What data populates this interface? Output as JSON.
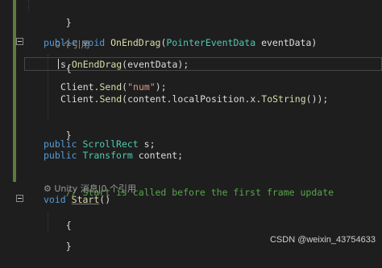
{
  "code": {
    "line_close_brace_top": "}",
    "codelens_refs_1": "0 个引用",
    "method_decl": {
      "kw_public": "public",
      "kw_void": "void",
      "name": "OnEndDrag",
      "open_paren": "(",
      "param_type": "PointerEventData",
      "param_name": " eventData",
      "close_paren": ")"
    },
    "open_brace_1": "{",
    "call_line": {
      "obj": "s.",
      "method": "OnEndDrag",
      "args": "(eventData);"
    },
    "send_line_1": {
      "obj": "Client.",
      "method": "Send",
      "open": "(",
      "string": "\"num\"",
      "close": ");"
    },
    "send_line_2": {
      "obj": "Client.",
      "method": "Send",
      "args_a": "(content.localPosition.x.",
      "method_b": "ToString",
      "args_b": "());"
    },
    "close_brace_1": "}",
    "field_1": {
      "kw": "public",
      "type": "ScrollRect",
      "name": " s;"
    },
    "field_2": {
      "kw": "public",
      "type": "Transform",
      "name": " content;"
    },
    "comment": "// Start is called before the first frame update",
    "codelens_unity": "Unity 消息|0 个引用",
    "start_decl": {
      "kw_void": "void",
      "name": "Start",
      "parens": "()"
    },
    "open_brace_2": "{",
    "close_brace_2": "}"
  },
  "watermark": "CSDN @weixin_43754633",
  "icons": {
    "fold_collapse": "minus-box-icon",
    "codelens_gear": "gear-icon"
  },
  "colors": {
    "background": "#1e1e1e",
    "keyword": "#569cd6",
    "type": "#4ec9b0",
    "method": "#dcdcaa",
    "string": "#d69d85",
    "comment": "#57a64a",
    "change_margin": "#5e7a3a"
  }
}
